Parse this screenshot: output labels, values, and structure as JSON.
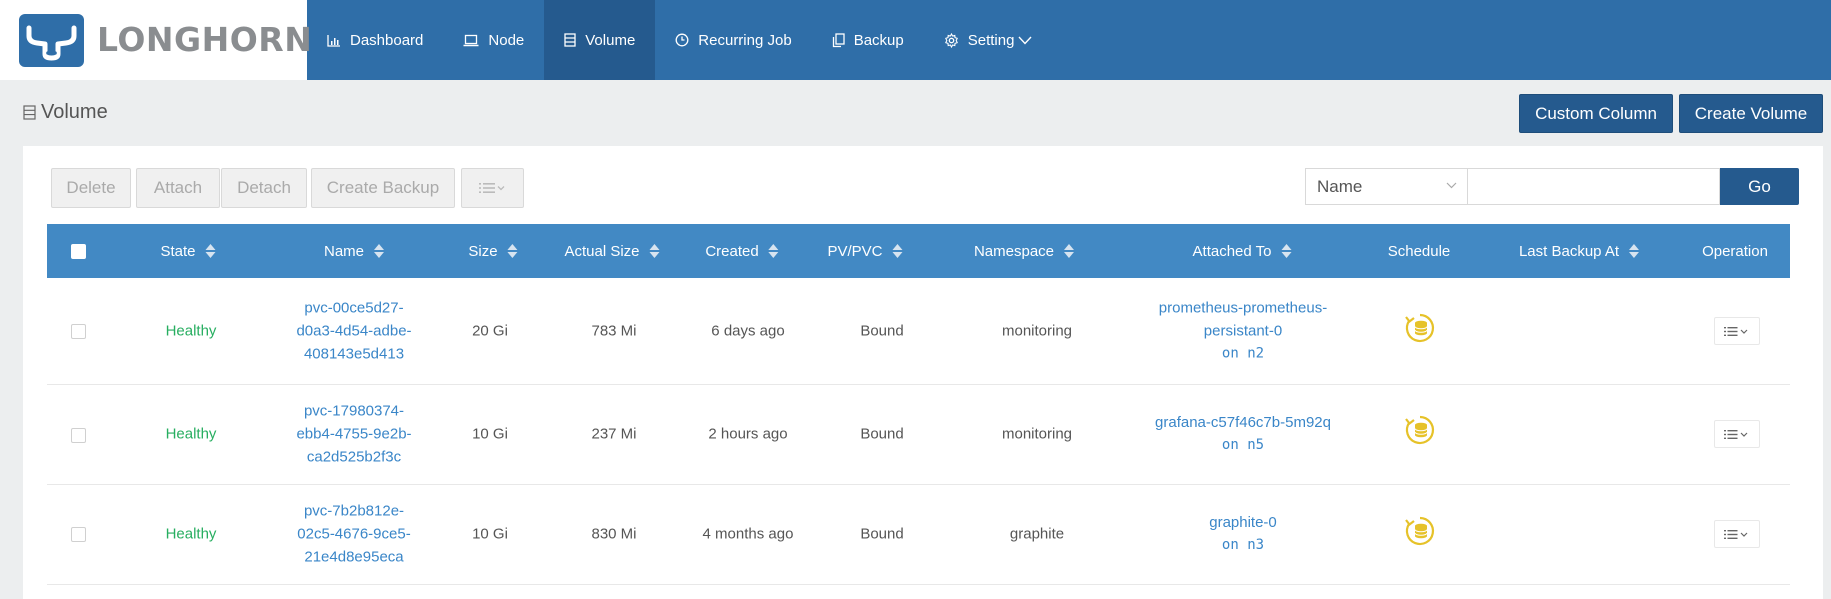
{
  "brand": {
    "name": "LONGHORN"
  },
  "nav": [
    {
      "label": "Dashboard",
      "icon": "bar-chart-icon"
    },
    {
      "label": "Node",
      "icon": "laptop-icon"
    },
    {
      "label": "Volume",
      "icon": "database-icon",
      "active": true
    },
    {
      "label": "Recurring Job",
      "icon": "clock-icon"
    },
    {
      "label": "Backup",
      "icon": "copy-icon"
    },
    {
      "label": "Setting",
      "icon": "gear-icon"
    }
  ],
  "page": {
    "title": "Volume",
    "custom_column": "Custom Column",
    "create_volume": "Create Volume"
  },
  "toolbar": {
    "delete": "Delete",
    "attach": "Attach",
    "detach": "Detach",
    "create_backup": "Create Backup"
  },
  "search": {
    "field": "Name",
    "value": "",
    "go": "Go"
  },
  "table": {
    "columns": [
      "State",
      "Name",
      "Size",
      "Actual Size",
      "Created",
      "PV/PVC",
      "Namespace",
      "Attached To",
      "Schedule",
      "Last Backup At",
      "Operation"
    ],
    "rows": [
      {
        "state": "Healthy",
        "name_lines": [
          "pvc-00ce5d27-",
          "d0a3-4d54-adbe-",
          "408143e5d413"
        ],
        "size": "20 Gi",
        "actual_size": "783 Mi",
        "created": "6 days ago",
        "pv_pvc": "Bound",
        "namespace": "monitoring",
        "attached_lines": [
          "prometheus-prometheus-",
          "persistant-0"
        ],
        "attached_node": "on n2",
        "last_backup": ""
      },
      {
        "state": "Healthy",
        "name_lines": [
          "pvc-17980374-",
          "ebb4-4755-9e2b-",
          "ca2d525b2f3c"
        ],
        "size": "10 Gi",
        "actual_size": "237 Mi",
        "created": "2 hours ago",
        "pv_pvc": "Bound",
        "namespace": "monitoring",
        "attached_lines": [
          "grafana-c57f46c7b-5m92q"
        ],
        "attached_node": "on n5",
        "last_backup": ""
      },
      {
        "state": "Healthy",
        "name_lines": [
          "pvc-7b2b812e-",
          "02c5-4676-9ce5-",
          "21e4d8e95eca"
        ],
        "size": "10 Gi",
        "actual_size": "830 Mi",
        "created": "4 months ago",
        "pv_pvc": "Bound",
        "namespace": "graphite",
        "attached_lines": [
          "graphite-0"
        ],
        "attached_node": "on n3",
        "last_backup": ""
      }
    ]
  },
  "colors": {
    "header": "#2f6ea8",
    "table_header": "#4289c4",
    "healthy": "#27ae60",
    "link": "#3a86c8",
    "schedule_icon": "#e6c229"
  }
}
